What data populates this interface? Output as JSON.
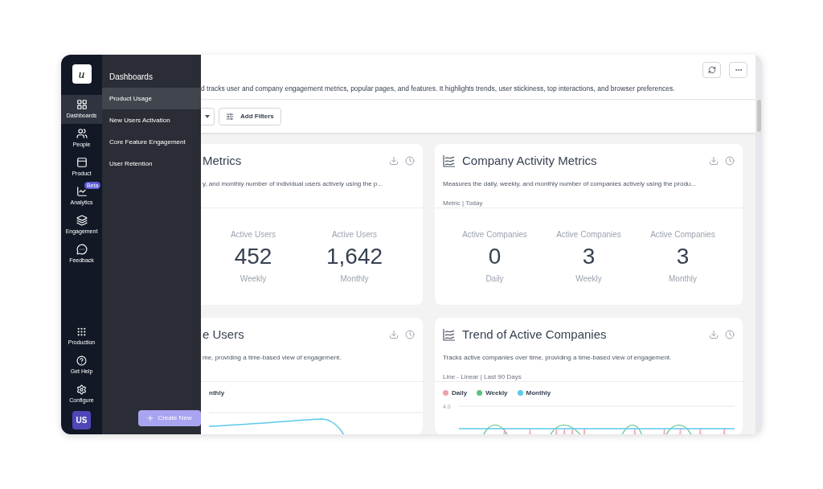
{
  "rail": {
    "logo": "u",
    "items": [
      {
        "label": "Dashboards",
        "selected": true
      },
      {
        "label": "People",
        "selected": false
      },
      {
        "label": "Product",
        "selected": false
      },
      {
        "label": "Analytics",
        "selected": false,
        "badge": "Beta"
      },
      {
        "label": "Engagement",
        "selected": false
      },
      {
        "label": "Feedback",
        "selected": false
      }
    ],
    "bottom_items": [
      {
        "label": "Production"
      },
      {
        "label": "Get Help"
      },
      {
        "label": "Configure"
      }
    ],
    "avatar": "US"
  },
  "flyout": {
    "title": "Dashboards",
    "items": [
      {
        "label": "Product Usage",
        "selected": true
      },
      {
        "label": "New Users Activation",
        "selected": false
      },
      {
        "label": "Core Feature Engagement",
        "selected": false
      },
      {
        "label": "User Retention",
        "selected": false
      }
    ],
    "create_button": "Create New"
  },
  "header": {
    "description": "d tracks user and company engagement metrics, popular pages, and features. It highlights trends, user stickiness, top interactions, and browser preferences."
  },
  "filters": {
    "add_filters": "Add Filters"
  },
  "cards": [
    {
      "kind": "metric",
      "title": "Metrics",
      "description": "y, and monthly number of individual users actively using the p...",
      "metrics": [
        {
          "label": "Active Users",
          "value": "452",
          "period": "Weekly"
        },
        {
          "label": "Active Users",
          "value": "1,642",
          "period": "Monthly"
        }
      ]
    },
    {
      "kind": "metric",
      "title": "Company Activity Metrics",
      "description": "Measures the daily, weekly, and monthly number of companies actively using the produ...",
      "meta": "Metric | Today",
      "metrics": [
        {
          "label": "Active Companies",
          "value": "0",
          "period": "Daily"
        },
        {
          "label": "Active Companies",
          "value": "3",
          "period": "Weekly"
        },
        {
          "label": "Active Companies",
          "value": "3",
          "period": "Monthly"
        }
      ]
    },
    {
      "kind": "chart",
      "title": "e Users",
      "description": "me, providing a time-based view of engagement.",
      "legend": [
        {
          "label": "nthly"
        }
      ]
    },
    {
      "kind": "chart",
      "title": "Trend of Active Companies",
      "description": "Tracks active companies over time, providing a time-based view of engagement.",
      "meta": "Line - Linear | Last 90 Days",
      "legend": [
        {
          "label": "Daily",
          "color": "#f0a0ad"
        },
        {
          "label": "Weekly",
          "color": "#5cc27f"
        },
        {
          "label": "Monthly",
          "color": "#5bc8ec"
        }
      ],
      "axis_label": "4.0"
    }
  ]
}
